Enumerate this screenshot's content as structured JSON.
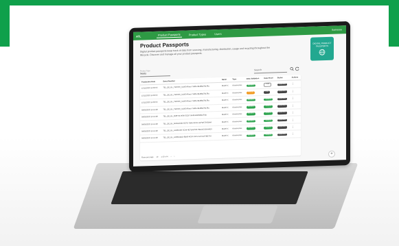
{
  "app": {
    "brand": "ATL",
    "nav": [
      "Product Passports",
      "Product Types",
      "Users"
    ],
    "active_nav_index": 0,
    "user_label": "Someone"
  },
  "page": {
    "title": "Product Passports",
    "description": "Digital product passports keep track of data from sourcing, manufacturing, distribution, usage and recycling throughout the lifecycle. Discover and manage all your product passports.",
    "badge_text": "DIGITAL PRODUCT PASSPORTS"
  },
  "filters": {
    "product_type_label": "Product Type",
    "product_type_value": "Seats",
    "search_placeholder": "Search"
  },
  "table": {
    "columns": [
      "Production Date",
      "Serial Number",
      "Name",
      "Type",
      "Data Validation",
      "Data Proof",
      "Status",
      "Actions"
    ],
    "rows": [
      [
        "15/11/2023 11:06:55",
        "TEL_SE_EL_TSH000_A1000-Rims-THRS-3B488a78a78a",
        "Model X",
        "Accessories",
        "Validated",
        "Draft",
        "Generated",
        "⋮"
      ],
      [
        "15/11/2023 11:06:55",
        "TEL_SE_EL_TSH000_A1000-Rims-THRS-3B488a78a78a",
        "Model X",
        "Accessories",
        "Pending",
        "Draft",
        "Generated",
        "⋮"
      ],
      [
        "15/11/2023 11:06:55",
        "TEL_SE_EL_TSH000_A1000-Rims-THRS-3B488a78a78a",
        "Model X",
        "Accessories",
        "Validated",
        "Validated",
        "Generated",
        "⋮"
      ],
      [
        "09/09/2023 11:14:48",
        "TEL_SE_EL_TSH000_A1000-Rims-THRS-3B488a78a78a",
        "Model X",
        "Accessories",
        "Validated",
        "Validated",
        "Generated",
        "⋮"
      ],
      [
        "09/09/2023 11:14:48",
        "TEL_SE_EL_6NRT-B-0000-3CB7-9A48-BAEB6BAF4B",
        "Model X",
        "Accessories",
        "Validated",
        "Validated",
        "Generated",
        "⋮"
      ],
      [
        "09/09/2023 11:14:48",
        "TEL_SE_EL_6N9A4C6B-0CFE-7B4A-9CA5-AeFBA73A5B4A",
        "Model X",
        "Accessories",
        "Validated",
        "Validated",
        "Generated",
        "⋮"
      ],
      [
        "09/09/2023 11:14:48",
        "TEL_SE_EL_AGR0A0H-3C44-4E7B-B7D8-76BA2C3OA44D5",
        "Model X",
        "Accessories",
        "Validated",
        "Validated",
        "Generated",
        "⋮"
      ],
      [
        "09/09/2023 11:14:48",
        "TEL_SE_EL_AOR6A4DD-8B40-4C5F-91F1-A47A4A7BE75A",
        "Model X",
        "Accessories",
        "Validated",
        "Validated",
        "Generated",
        "⋮"
      ]
    ],
    "pill_styles": {
      "Data Validation": [
        "green",
        "orange",
        "green",
        "green",
        "green",
        "green",
        "green",
        "green"
      ],
      "Data Proof": [
        "outline",
        "dark",
        "green",
        "green",
        "green",
        "green",
        "green",
        "green"
      ],
      "Status": [
        "dark",
        "dark",
        "dark",
        "dark",
        "dark",
        "dark",
        "dark",
        "dark"
      ]
    }
  },
  "pager": {
    "rows_per_page_label": "Rows per page",
    "rows_per_page_value": "10",
    "range_label": "1-10 of 4"
  },
  "colors": {
    "brand_green": "#0fa04b",
    "topbar_green": "#2e9a44",
    "badge_teal": "#23a890",
    "pill_green": "#2ea44f",
    "pill_orange": "#f29b22",
    "pill_dark": "#444444"
  },
  "icons": {
    "search": "search-icon",
    "refresh": "refresh-icon",
    "globe": "globe-icon",
    "add": "add-icon"
  }
}
